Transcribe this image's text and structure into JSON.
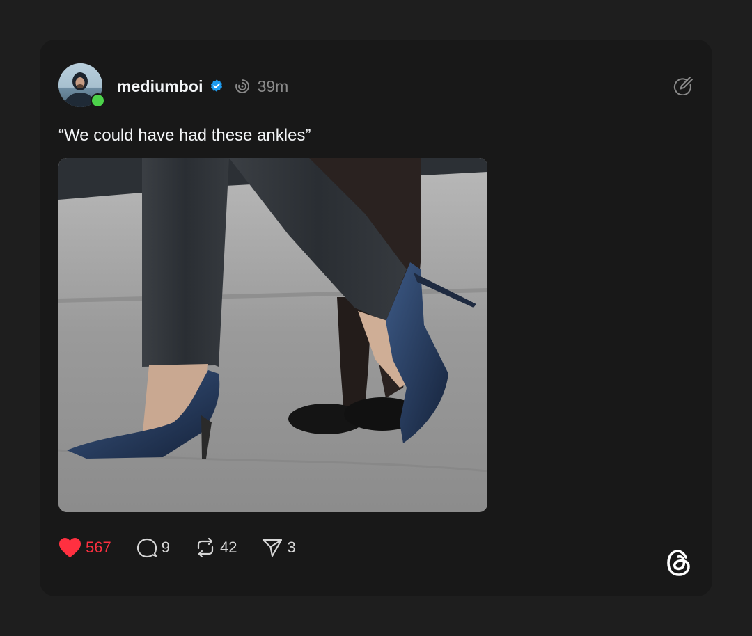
{
  "post": {
    "username": "mediumboi",
    "timestamp": "39m",
    "text": "“We could have had these ankles”",
    "verified_color": "#1d9bf0",
    "online_color": "#4cd24a"
  },
  "actions": {
    "likes": "567",
    "replies": "9",
    "reposts": "42",
    "shares": "3",
    "like_color": "#ff3040"
  },
  "icons": {
    "verified": "verified-badge-icon",
    "ring": "threads-ring-icon",
    "edit": "edit-compose-icon",
    "heart": "heart-icon",
    "reply": "reply-bubble-icon",
    "repost": "repost-icon",
    "share": "share-send-icon",
    "logo": "threads-logo-icon"
  }
}
